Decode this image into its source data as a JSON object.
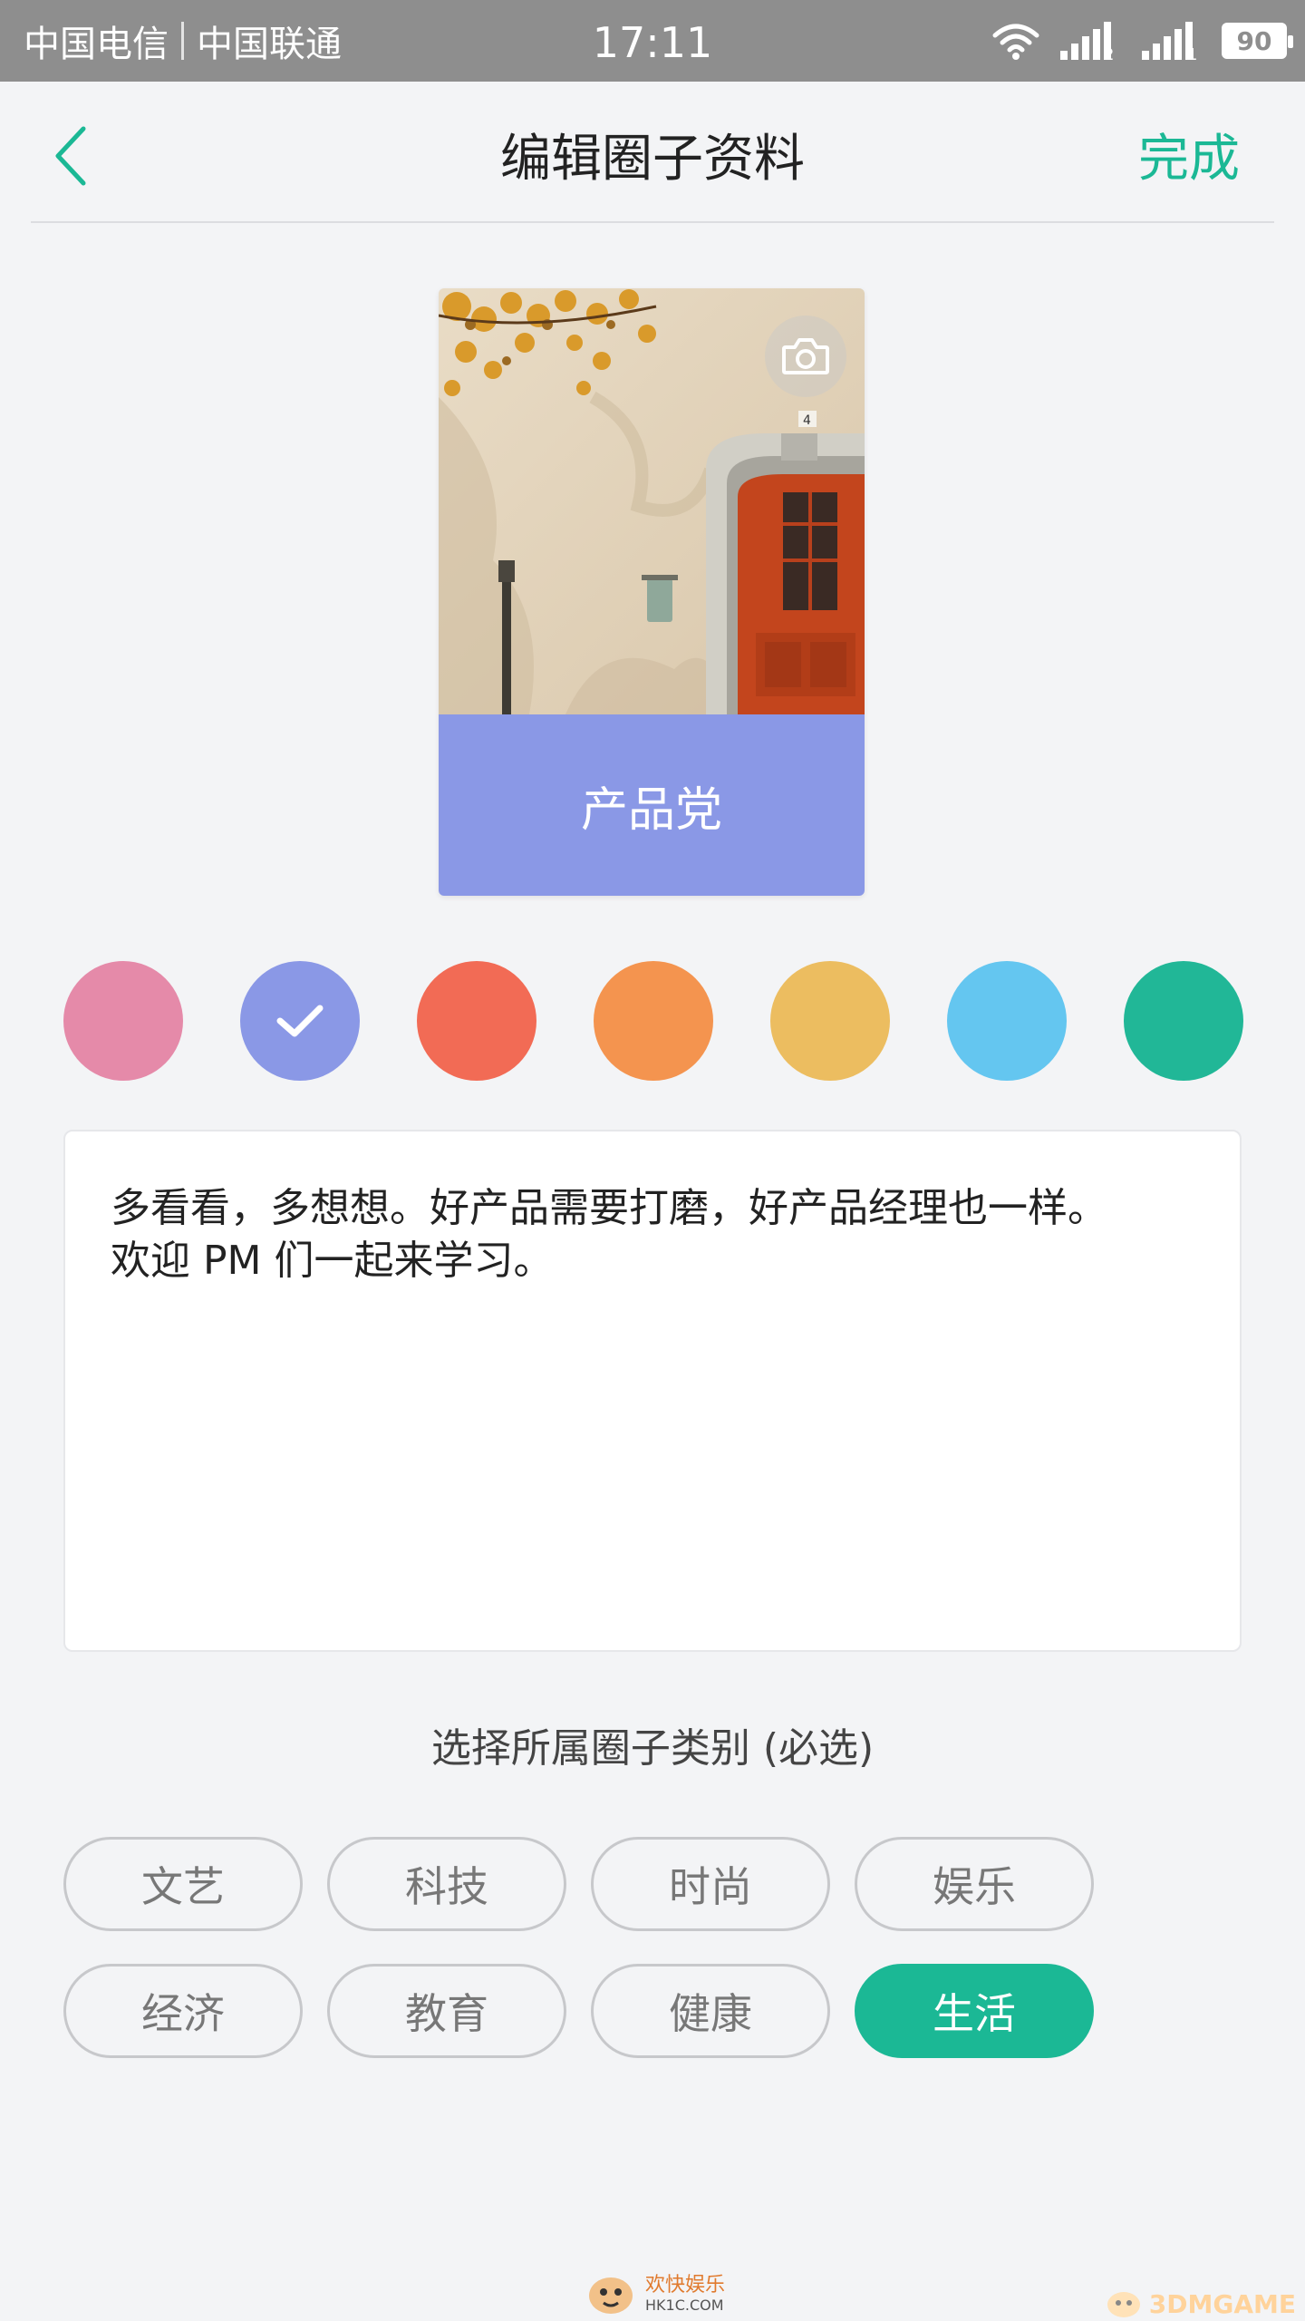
{
  "status_bar": {
    "carrier_1": "中国电信",
    "carrier_2": "中国联通",
    "time": "17:11",
    "battery": "90",
    "sim_1_index": "2",
    "sim_2_index": "1"
  },
  "nav": {
    "title": "编辑圈子资料",
    "done_label": "完成",
    "back_icon": "chevron-left-icon"
  },
  "cover": {
    "circle_name": "产品党",
    "camera_icon": "camera-icon",
    "selected_color": "#8a98e6"
  },
  "colors": {
    "options": [
      "#e58aa9",
      "#8a98e6",
      "#f26b55",
      "#f4944f",
      "#ecbd60",
      "#64c6f0",
      "#21b797"
    ],
    "selected_index": 1
  },
  "description": {
    "text": "多看看，多想想。好产品需要打磨，好产品经理也一样。\n欢迎 PM 们一起来学习。"
  },
  "category": {
    "heading": "选择所属圈子类别 (必选)",
    "options": [
      "文艺",
      "科技",
      "时尚",
      "娱乐",
      "经济",
      "教育",
      "健康",
      "生活"
    ],
    "selected": "生活"
  },
  "watermarks": {
    "left_title": "欢快娱乐",
    "left_url": "HK1C.COM",
    "right": "3DMGAME"
  },
  "accent_color": "#1bb895"
}
